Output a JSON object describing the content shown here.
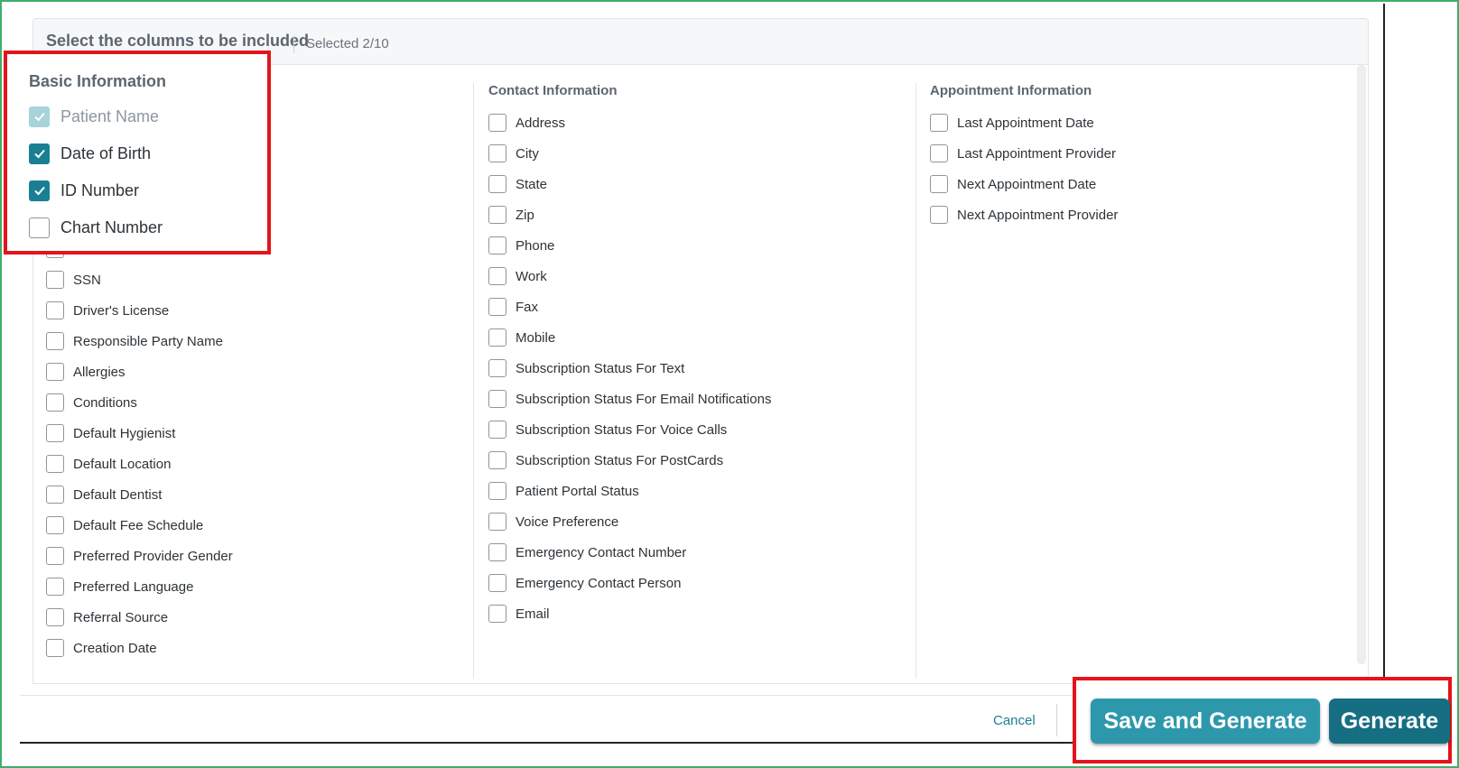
{
  "header": {
    "title": "Select the columns to be included",
    "selected_count": "Selected 2/10"
  },
  "basic": {
    "title": "Basic Information",
    "items": [
      {
        "label": "Patient Name",
        "state": "checked-disabled"
      },
      {
        "label": "Date of Birth",
        "state": "checked"
      },
      {
        "label": "ID Number",
        "state": "checked"
      },
      {
        "label": "Chart Number",
        "state": "unchecked"
      }
    ],
    "more": [
      "SSN",
      "Driver's License",
      "Responsible Party Name",
      "Allergies",
      "Conditions",
      "Default Hygienist",
      "Default Location",
      "Default Dentist",
      "Default Fee Schedule",
      "Preferred Provider Gender",
      "Preferred Language",
      "Referral Source",
      "Creation Date"
    ]
  },
  "contact": {
    "title": "Contact Information",
    "items": [
      "Address",
      "City",
      "State",
      "Zip",
      "Phone",
      "Work",
      "Fax",
      "Mobile",
      "Subscription Status For Text",
      "Subscription Status For Email Notifications",
      "Subscription Status For Voice Calls",
      "Subscription Status For PostCards",
      "Patient Portal Status",
      "Voice Preference",
      "Emergency Contact Number",
      "Emergency Contact Person",
      "Email"
    ]
  },
  "appointment": {
    "title": "Appointment Information",
    "items": [
      "Last Appointment Date",
      "Last Appointment Provider",
      "Next Appointment Date",
      "Next Appointment Provider"
    ]
  },
  "footer": {
    "cancel_label": "Cancel",
    "save_generate_label": "Save and Generate",
    "generate_label": "Generate"
  },
  "colors": {
    "accent": "#1a7f93",
    "highlight_border": "#e3151b",
    "frame_border": "#3fae6a"
  }
}
